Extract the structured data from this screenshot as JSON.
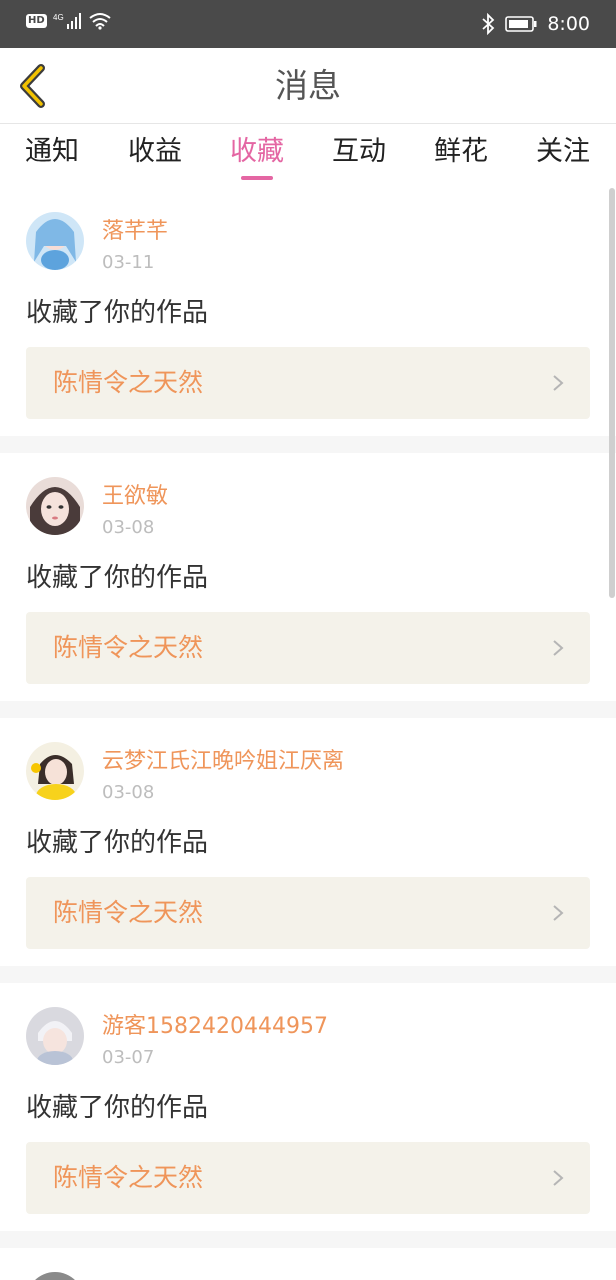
{
  "status_bar": {
    "hd": "HD",
    "network": "4G",
    "time": "8:00"
  },
  "header": {
    "title": "消息"
  },
  "tabs": [
    {
      "label": "通知"
    },
    {
      "label": "收益"
    },
    {
      "label": "收藏"
    },
    {
      "label": "互动"
    },
    {
      "label": "鲜花"
    },
    {
      "label": "关注"
    }
  ],
  "active_tab": "收藏",
  "items": [
    {
      "name": "落芊芊",
      "date": "03-11",
      "action": "收藏了你的作品",
      "work": "陈情令之天然"
    },
    {
      "name": "王欲敏",
      "date": "03-08",
      "action": "收藏了你的作品",
      "work": "陈情令之天然"
    },
    {
      "name": "云梦江氏江晚吟姐江厌离",
      "date": "03-08",
      "action": "收藏了你的作品",
      "work": "陈情令之天然"
    },
    {
      "name": "游客1582420444957",
      "date": "03-07",
      "action": "收藏了你的作品",
      "work": "陈情令之天然"
    }
  ],
  "colors": {
    "accent_pink": "#e466a3",
    "name_orange": "#ef955a",
    "work_bg": "#f4f2ea"
  }
}
